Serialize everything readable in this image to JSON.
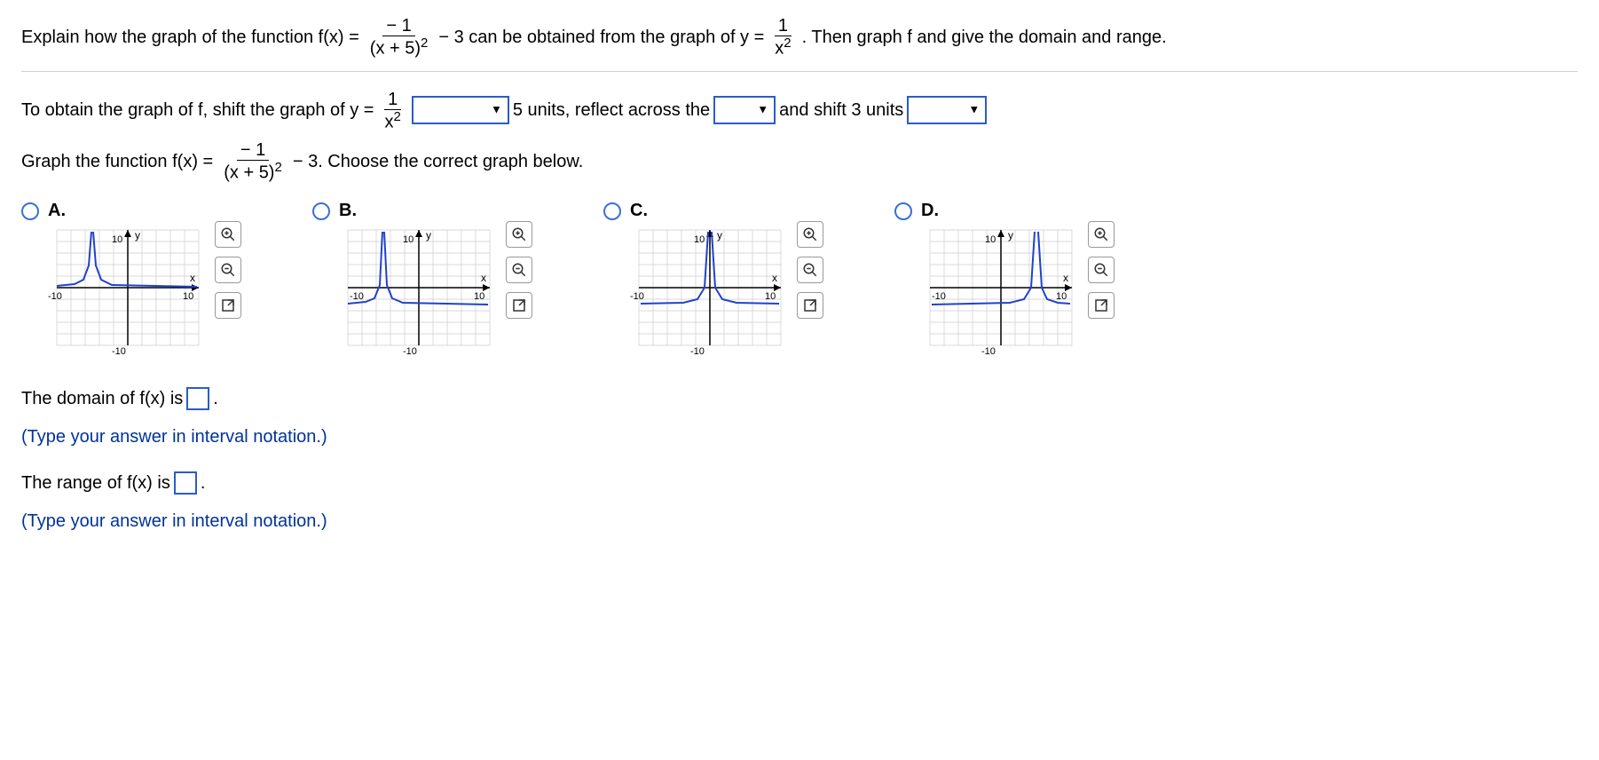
{
  "header": {
    "t1": "Explain how the graph of the function f(x) =",
    "f1_num": "− 1",
    "f1_den_a": "(x + 5)",
    "f1_den_exp": "2",
    "t2": "− 3 can be obtained from the graph of y =",
    "f2_num": "1",
    "f2_den_a": "x",
    "f2_den_exp": "2",
    "t3": ". Then graph f and give the domain and range."
  },
  "step1": {
    "t1": "To obtain the graph of f, shift the graph of y =",
    "f_num": "1",
    "f_den_a": "x",
    "f_den_exp": "2",
    "t2": "5 units, reflect across the",
    "t3": "and shift 3 units"
  },
  "step2": {
    "t1": "Graph the function f(x) =",
    "f_num": "− 1",
    "f_den_a": "(x + 5)",
    "f_den_exp": "2",
    "t2": "− 3. Choose the correct graph below."
  },
  "options": {
    "a": "A.",
    "b": "B.",
    "c": "C.",
    "d": "D."
  },
  "graph_labels": {
    "y": "y",
    "x": "x",
    "pos10": "10",
    "neg10": "-10",
    "pos10s": "10",
    "neg10s": "-10"
  },
  "domain": {
    "t1": "The domain of f(x) is",
    "t2": ".",
    "hint": "(Type your answer in interval notation.)"
  },
  "range": {
    "t1": "The range of f(x) is",
    "t2": ".",
    "hint": "(Type your answer in interval notation.)"
  },
  "chart_data": [
    {
      "id": "A",
      "type": "line",
      "xlim": [
        -10,
        10
      ],
      "ylim": [
        -10,
        10
      ],
      "asymptote_x": -5,
      "asymptote_y": 0,
      "shape": "reflected_down_no_vshift"
    },
    {
      "id": "B",
      "type": "line",
      "xlim": [
        -10,
        10
      ],
      "ylim": [
        -10,
        10
      ],
      "asymptote_x": -5,
      "asymptote_y": -3,
      "shape": "reflected_down_correct"
    },
    {
      "id": "C",
      "type": "line",
      "xlim": [
        -10,
        10
      ],
      "ylim": [
        -10,
        10
      ],
      "asymptote_x": 0,
      "asymptote_y": -3,
      "shape": "reflected_down_no_hshift"
    },
    {
      "id": "D",
      "type": "line",
      "xlim": [
        -10,
        10
      ],
      "ylim": [
        -10,
        10
      ],
      "asymptote_x": 5,
      "asymptote_y": -3,
      "shape": "reflected_down_shift_right"
    }
  ]
}
